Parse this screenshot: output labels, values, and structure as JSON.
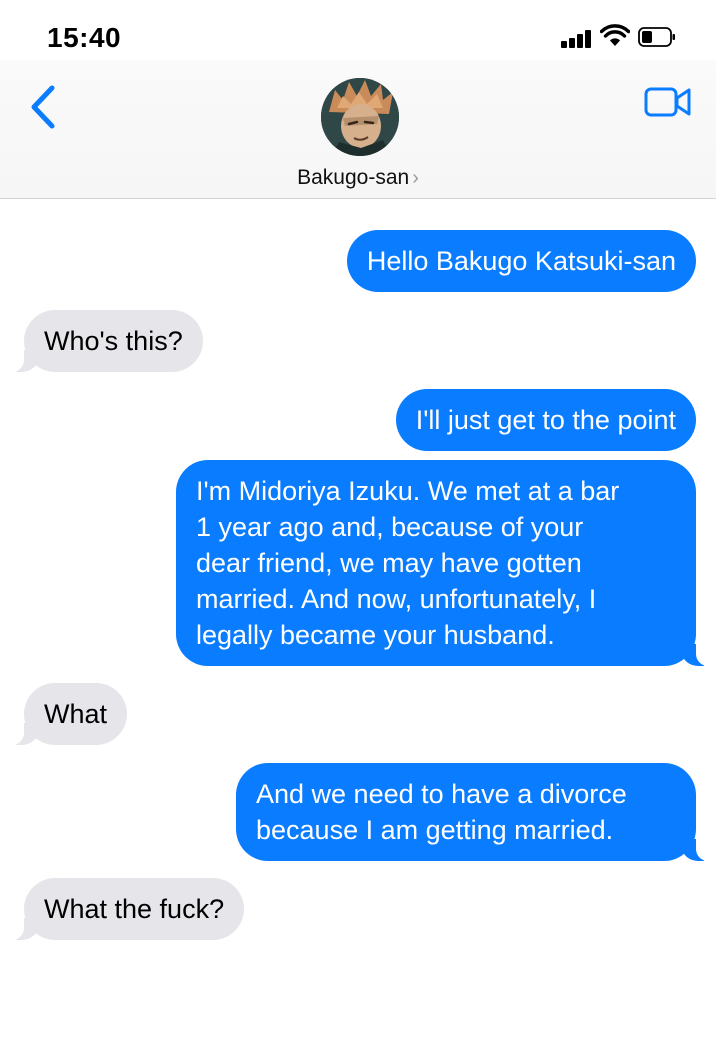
{
  "status_bar": {
    "time": "15:40",
    "signal_icon": "signal-bars-icon",
    "wifi_icon": "wifi-icon",
    "battery_icon": "battery-icon"
  },
  "header": {
    "contact_name": "Bakugo-san",
    "chevron": "›",
    "back_icon": "chevron-left-icon",
    "video_icon": "video-camera-icon",
    "accent_color": "#0a7cff"
  },
  "messages": [
    {
      "direction": "sent",
      "text": "Hello Bakugo Katsuki-san"
    },
    {
      "direction": "received",
      "text": "Who's this?"
    },
    {
      "direction": "sent",
      "text": "I'll just get to the point"
    },
    {
      "direction": "sent",
      "lines": [
        "I'm Midoriya Izuku. We met at a bar",
        "1 year ago and, because of your",
        "dear friend, we may have gotten",
        "married. And now, unfortunately, I",
        "legally became your husband."
      ]
    },
    {
      "direction": "received",
      "text": "What"
    },
    {
      "direction": "sent",
      "lines": [
        "And we need to have a divorce",
        "because I am getting married."
      ]
    },
    {
      "direction": "received",
      "text": "What the fuck?"
    }
  ],
  "colors": {
    "sent_bubble": "#0a7cff",
    "received_bubble": "#e5e5ea"
  }
}
